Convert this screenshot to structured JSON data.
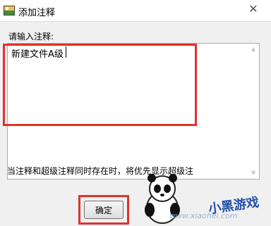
{
  "window": {
    "title": "添加注释",
    "close_glyph": "✕"
  },
  "prompt": {
    "label": "请输入注释:"
  },
  "annotation_input": {
    "value": "新建文件A级"
  },
  "note": {
    "text": "当注释和超级注释同时存在时，将优先显示超级注"
  },
  "buttons": {
    "ok_label": "确定"
  },
  "watermark": {
    "url": "www.xiaohei.com",
    "brand": "小黑游戏"
  },
  "colors": {
    "highlight": "#e0322a",
    "dialog_bg": "#f0f0f0"
  }
}
